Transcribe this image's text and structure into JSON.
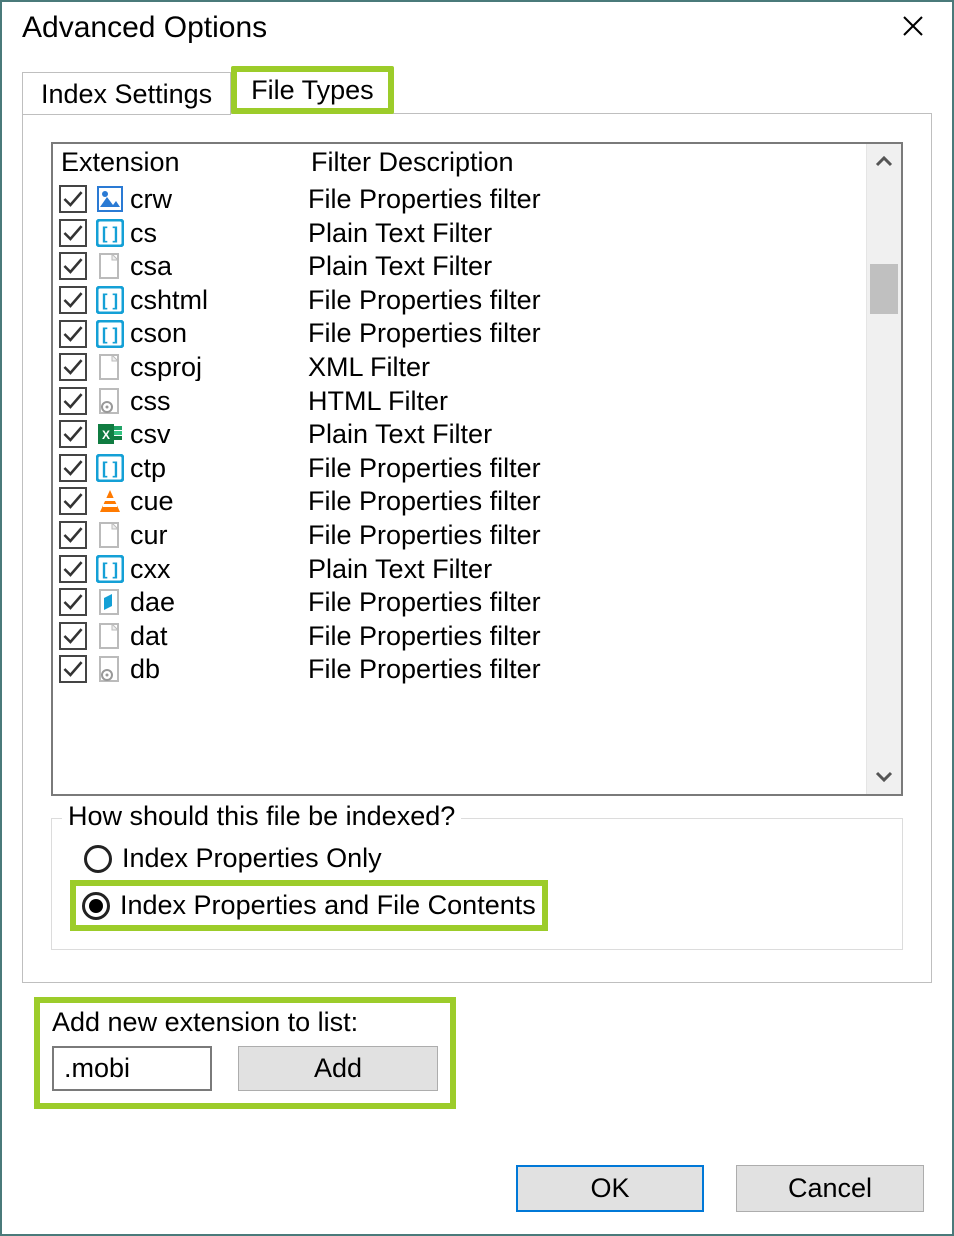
{
  "window": {
    "title": "Advanced Options"
  },
  "tabs": {
    "index_settings": "Index Settings",
    "file_types": "File Types",
    "active": "file_types"
  },
  "list": {
    "headers": {
      "extension": "Extension",
      "filter": "Filter Description"
    },
    "rows": [
      {
        "checked": true,
        "icon": "image",
        "ext": "crw",
        "filter": "File Properties filter"
      },
      {
        "checked": true,
        "icon": "bracket",
        "ext": "cs",
        "filter": "Plain Text Filter"
      },
      {
        "checked": true,
        "icon": "blank",
        "ext": "csa",
        "filter": "Plain Text Filter"
      },
      {
        "checked": true,
        "icon": "bracket",
        "ext": "cshtml",
        "filter": "File Properties filter"
      },
      {
        "checked": true,
        "icon": "bracket",
        "ext": "cson",
        "filter": "File Properties filter"
      },
      {
        "checked": true,
        "icon": "blank",
        "ext": "csproj",
        "filter": "XML Filter"
      },
      {
        "checked": true,
        "icon": "gear",
        "ext": "css",
        "filter": "HTML Filter"
      },
      {
        "checked": true,
        "icon": "excel",
        "ext": "csv",
        "filter": "Plain Text Filter"
      },
      {
        "checked": true,
        "icon": "bracket",
        "ext": "ctp",
        "filter": "File Properties filter"
      },
      {
        "checked": true,
        "icon": "cone",
        "ext": "cue",
        "filter": "File Properties filter"
      },
      {
        "checked": true,
        "icon": "blank",
        "ext": "cur",
        "filter": "File Properties filter"
      },
      {
        "checked": true,
        "icon": "bracket",
        "ext": "cxx",
        "filter": "Plain Text Filter"
      },
      {
        "checked": true,
        "icon": "doc3d",
        "ext": "dae",
        "filter": "File Properties filter"
      },
      {
        "checked": true,
        "icon": "blank",
        "ext": "dat",
        "filter": "File Properties filter"
      },
      {
        "checked": true,
        "icon": "gear",
        "ext": "db",
        "filter": "File Properties filter"
      }
    ]
  },
  "index_group": {
    "legend": "How should this file be indexed?",
    "opt_properties_only": "Index Properties Only",
    "opt_properties_contents": "Index Properties and File Contents",
    "selected": "contents"
  },
  "add_ext": {
    "label": "Add new extension to list:",
    "value": ".mobi",
    "button": "Add"
  },
  "footer": {
    "ok": "OK",
    "cancel": "Cancel"
  },
  "highlight_color": "#9ccc2a"
}
